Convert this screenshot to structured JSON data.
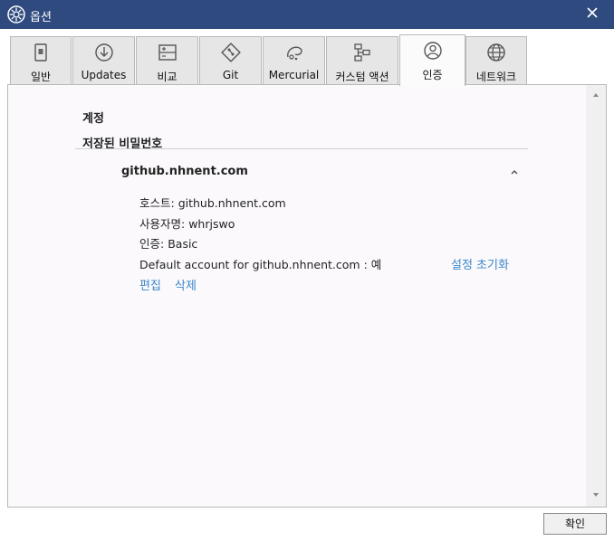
{
  "window": {
    "title": "옵션",
    "icon": "gear-icon",
    "close_icon": "close-icon"
  },
  "tabs": [
    {
      "label": "일반",
      "icon": "general-icon"
    },
    {
      "label": "Updates",
      "icon": "download-icon"
    },
    {
      "label": "비교",
      "icon": "compare-icon"
    },
    {
      "label": "Git",
      "icon": "git-icon"
    },
    {
      "label": "Mercurial",
      "icon": "mercurial-icon"
    },
    {
      "label": "커스텀 액션",
      "icon": "custom-action-icon"
    },
    {
      "label": "인증",
      "icon": "user-icon",
      "active": true
    },
    {
      "label": "네트워크",
      "icon": "globe-icon"
    }
  ],
  "auth": {
    "section_title": "계정",
    "saved_passwords_title": "저장된 비밀번호",
    "account": {
      "name": "github.nhnent.com",
      "host_label": "호스트:",
      "host": "github.nhnent.com",
      "username_label": "사용자명:",
      "username": "whrjswo",
      "auth_label": "인증:",
      "auth": "Basic",
      "default_label": "Default account for github.nhnent.com :",
      "default_value": "예",
      "reset_link": "설정 초기화",
      "edit_link": "편집",
      "delete_link": "삭제"
    }
  },
  "footer": {
    "ok_label": "확인"
  },
  "colors": {
    "titlebar": "#2e4a7e",
    "link": "#3a87c9",
    "panel": "#fbf9fc"
  }
}
